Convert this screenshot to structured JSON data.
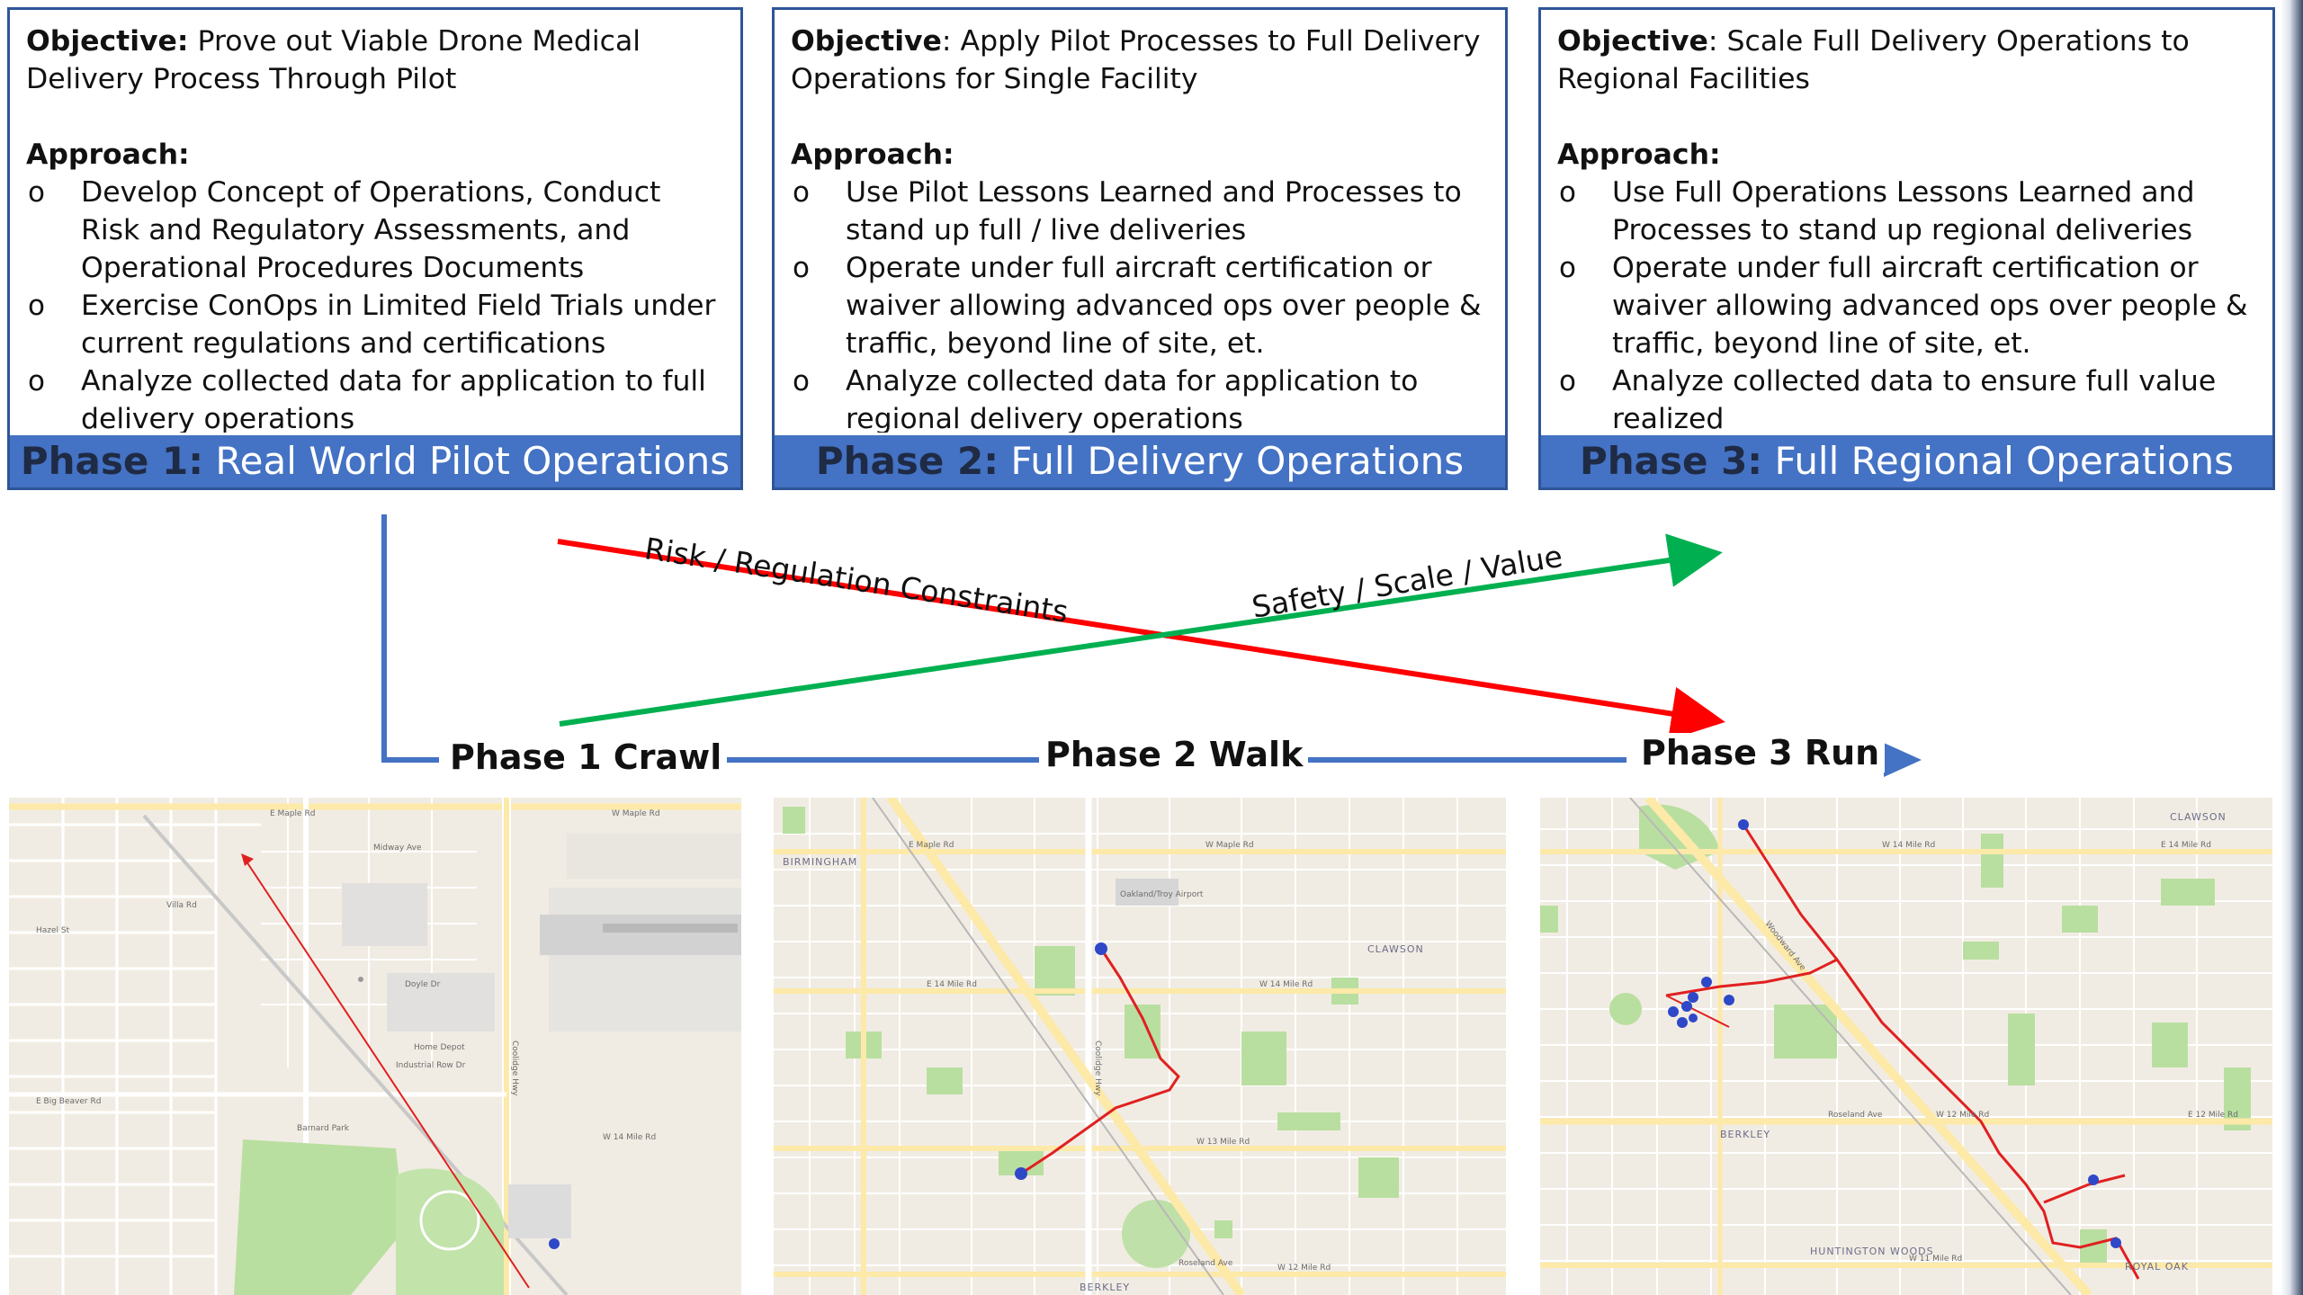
{
  "phases": [
    {
      "objective_label": "Objective:",
      "objective_text": "Prove out Viable Drone Medical Delivery Process Through Pilot",
      "approach_label": "Approach:",
      "bullets": [
        "Develop Concept of Operations, Conduct Risk and Regulatory Assessments, and Operational Procedures Documents",
        "Exercise ConOps in Limited Field Trials under current regulations and certifications",
        "Analyze collected data for application to full delivery operations"
      ],
      "header_num": "Phase 1:",
      "header_name": "Real World Pilot Operations"
    },
    {
      "objective_label": "Objective",
      "objective_text": ": Apply Pilot Processes to Full Delivery Operations for Single Facility",
      "approach_label": "Approach:",
      "bullets": [
        "Use Pilot Lessons Learned and Processes to stand up full / live deliveries",
        "Operate under full aircraft certification or waiver allowing advanced ops over people & traffic, beyond line of site, et.",
        "Analyze collected data for application to regional delivery operations"
      ],
      "header_num": "Phase 2:",
      "header_name": "Full Delivery Operations"
    },
    {
      "objective_label": "Objective",
      "objective_text": ": Scale Full Delivery Operations to Regional Facilities",
      "approach_label": "Approach:",
      "bullets": [
        "Use Full Operations Lessons Learned and Processes to stand up regional deliveries",
        "Operate under full aircraft certification or waiver allowing advanced ops over people & traffic, beyond line of site, et.",
        "Analyze collected data to ensure full value realized"
      ],
      "header_num": "Phase 3:",
      "header_name": "Full Regional Operations"
    }
  ],
  "diagram": {
    "red_arrow_label": "Risk / Regulation Constraints",
    "green_arrow_label": "Safety / Scale / Value",
    "stages": [
      "Phase 1 Crawl",
      "Phase 2 Walk",
      "Phase 3 Run"
    ],
    "colors": {
      "red": "#ff0000",
      "green": "#00b050",
      "blue": "#4472c4",
      "header": "#4472c4"
    }
  },
  "maps": {
    "map1": {
      "labels": [
        "E Maple Rd",
        "W Maple Rd",
        "Villa Rd",
        "Hazel St",
        "Midway Ave",
        "Doyle Dr",
        "Industrial Row Dr",
        "Home Depot",
        "Coolidge Hwy",
        "W 14 Mile Rd",
        "E Big Beaver Rd",
        "Barnard Park"
      ]
    },
    "map2": {
      "labels": [
        "BIRMINGHAM",
        "E Maple Rd",
        "W Maple Rd",
        "E 14 Mile Rd",
        "W 14 Mile Rd",
        "CLAWSON",
        "W 13 Mile Rd",
        "W 12 Mile Rd",
        "Roseland Ave",
        "BERKLEY",
        "Coolidge Hwy",
        "Oakland/Troy Airport"
      ]
    },
    "map3": {
      "labels": [
        "CLAWSON",
        "E 14 Mile Rd",
        "W 14 Mile Rd",
        "BERKLEY",
        "W 12 Mile Rd",
        "E 12 Mile Rd",
        "HUNTINGTON WOODS",
        "ROYAL OAK",
        "Roseland Ave",
        "W 11 Mile Rd",
        "Woodward Ave"
      ]
    }
  }
}
